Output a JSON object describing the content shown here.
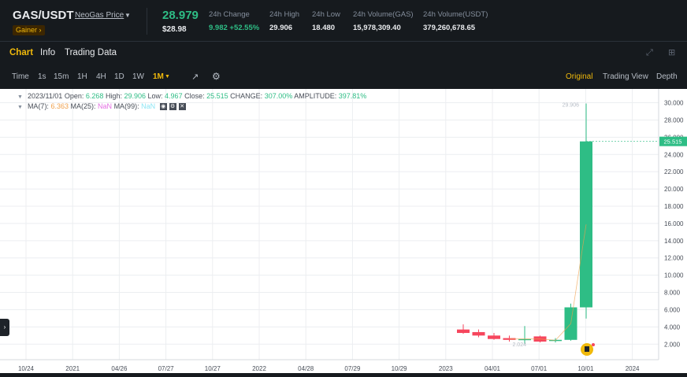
{
  "header": {
    "pair": "GAS/USDT",
    "pair_name": "NeoGas Price",
    "badge": "Gainer",
    "badge_arrow": "›",
    "price": "28.979",
    "price_usd": "$28.98",
    "stats": [
      {
        "label": "24h Change",
        "value": "9.982 +52.55%",
        "positive": true
      },
      {
        "label": "24h High",
        "value": "29.906"
      },
      {
        "label": "24h Low",
        "value": "18.480"
      },
      {
        "label": "24h Volume(GAS)",
        "value": "15,978,309.40"
      },
      {
        "label": "24h Volume(USDT)",
        "value": "379,260,678.65"
      }
    ]
  },
  "tabs": [
    {
      "label": "Chart",
      "active": true
    },
    {
      "label": "Info",
      "active": false
    },
    {
      "label": "Trading Data",
      "active": false
    }
  ],
  "toolbar": {
    "intervals": [
      "Time",
      "1s",
      "15m",
      "1H",
      "4H",
      "1D",
      "1W",
      "1M"
    ],
    "active_interval": "1M",
    "views": [
      "Original",
      "Trading View",
      "Depth"
    ],
    "active_view": "Original"
  },
  "legend": {
    "date": "2023/11/01",
    "open_label": "Open:",
    "open": "6.268",
    "high_label": "High:",
    "high": "29.906",
    "low_label": "Low:",
    "low": "4.967",
    "close_label": "Close:",
    "close": "25.515",
    "change_label": "CHANGE:",
    "change": "307.00%",
    "amplitude_label": "AMPLITUDE:",
    "amplitude": "397.81%",
    "ma7_label": "MA(7):",
    "ma7": "6.363",
    "ma25_label": "MA(25):",
    "ma25": "NaN",
    "ma99_label": "MA(99):",
    "ma99": "NaN"
  },
  "colors": {
    "up": "#2ebd85",
    "down": "#f6465d",
    "accent": "#f0b90b"
  },
  "chart_data": {
    "type": "candlestick",
    "x_tick_labels": [
      "10/24",
      "2021",
      "04/26",
      "07/27",
      "10/27",
      "2022",
      "04/28",
      "07/29",
      "10/29",
      "2023",
      "04/01",
      "07/01",
      "10/01",
      "2024"
    ],
    "y_tick_labels": [
      "30.000",
      "28.000",
      "26.000",
      "24.000",
      "22.000",
      "20.000",
      "18.000",
      "16.000",
      "14.000",
      "12.000",
      "10.000",
      "8.000",
      "6.000",
      "4.000",
      "2.000"
    ],
    "y_ticks": [
      30,
      28,
      26,
      24,
      22,
      20,
      18,
      16,
      14,
      12,
      10,
      8,
      6,
      4,
      2
    ],
    "ylim": [
      0.2,
      31.6
    ],
    "last_price_label": "25.515",
    "last_price": 25.515,
    "high_marker_label": "29.906",
    "low_marker_label": "2.024",
    "candles": [
      {
        "x": 0,
        "open": 3.7,
        "high": 4.3,
        "low": 3.2,
        "close": 3.3
      },
      {
        "x": 1,
        "open": 3.4,
        "high": 3.7,
        "low": 2.8,
        "close": 3.0
      },
      {
        "x": 2,
        "open": 3.0,
        "high": 3.3,
        "low": 2.5,
        "close": 2.6
      },
      {
        "x": 3,
        "open": 2.7,
        "high": 3.0,
        "low": 2.3,
        "close": 2.5
      },
      {
        "x": 4,
        "open": 2.6,
        "high": 4.1,
        "low": 2.024,
        "close": 2.6
      },
      {
        "x": 5,
        "open": 2.9,
        "high": 3.0,
        "low": 2.2,
        "close": 2.3
      },
      {
        "x": 6,
        "open": 2.4,
        "high": 2.7,
        "low": 2.2,
        "close": 2.5
      },
      {
        "x": 7,
        "open": 2.5,
        "high": 6.7,
        "low": 2.4,
        "close": 6.27
      },
      {
        "x": 8,
        "open": 6.268,
        "high": 29.906,
        "low": 4.967,
        "close": 25.515
      }
    ]
  }
}
